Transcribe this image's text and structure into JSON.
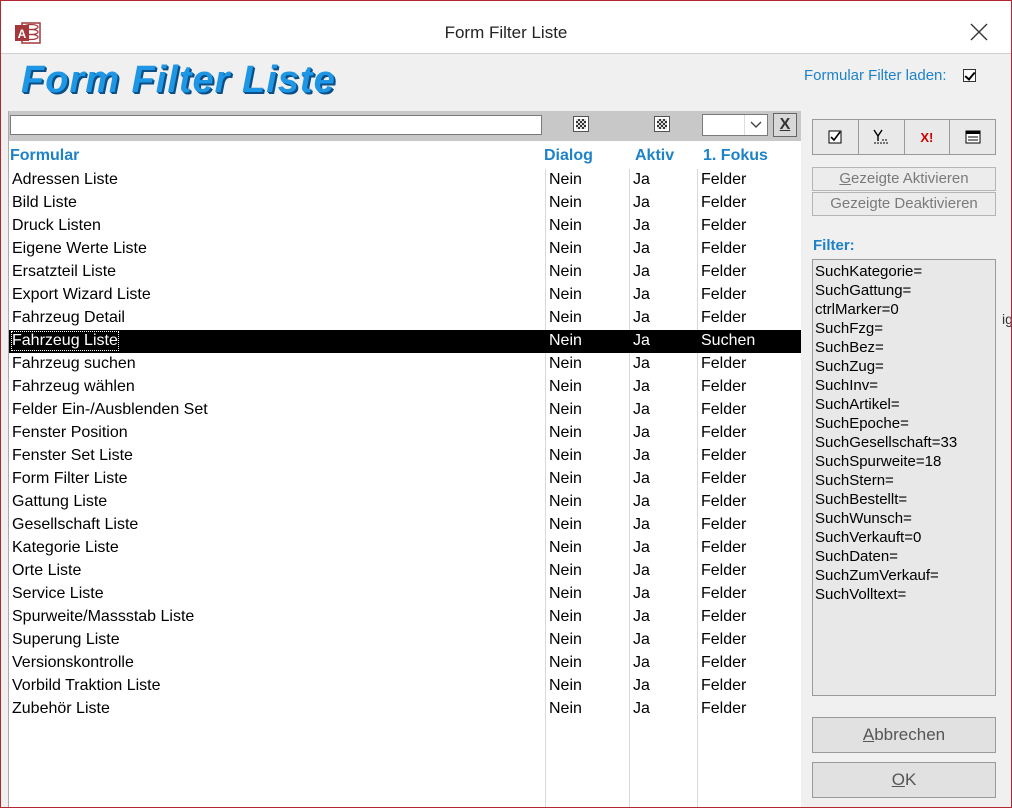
{
  "window": {
    "title": "Form Filter Liste",
    "app_icon": "access-icon",
    "close_icon": "close-icon"
  },
  "header": {
    "big_title": "Form Filter Liste",
    "formular_filter_label": "Formular Filter laden:",
    "formular_filter_checked": true
  },
  "filter_bar": {
    "search_value": "",
    "combo_value": "",
    "clear_label": "X"
  },
  "columns": [
    "Formular",
    "Dialog",
    "Aktiv",
    "1. Fokus"
  ],
  "rows": [
    {
      "name": "Adressen Liste",
      "dialog": "Nein",
      "aktiv": "Ja",
      "fokus": "Felder"
    },
    {
      "name": "Bild Liste",
      "dialog": "Nein",
      "aktiv": "Ja",
      "fokus": "Felder"
    },
    {
      "name": "Druck Listen",
      "dialog": "Nein",
      "aktiv": "Ja",
      "fokus": "Felder"
    },
    {
      "name": "Eigene Werte Liste",
      "dialog": "Nein",
      "aktiv": "Ja",
      "fokus": "Felder"
    },
    {
      "name": "Ersatzteil Liste",
      "dialog": "Nein",
      "aktiv": "Ja",
      "fokus": "Felder"
    },
    {
      "name": "Export Wizard Liste",
      "dialog": "Nein",
      "aktiv": "Ja",
      "fokus": "Felder"
    },
    {
      "name": "Fahrzeug Detail",
      "dialog": "Nein",
      "aktiv": "Ja",
      "fokus": "Felder"
    },
    {
      "name": "Fahrzeug Liste",
      "dialog": "Nein",
      "aktiv": "Ja",
      "fokus": "Suchen",
      "selected": true
    },
    {
      "name": "Fahrzeug suchen",
      "dialog": "Nein",
      "aktiv": "Ja",
      "fokus": "Felder"
    },
    {
      "name": "Fahrzeug wählen",
      "dialog": "Nein",
      "aktiv": "Ja",
      "fokus": "Felder"
    },
    {
      "name": "Felder Ein-/Ausblenden Set",
      "dialog": "Nein",
      "aktiv": "Ja",
      "fokus": "Felder"
    },
    {
      "name": "Fenster Position",
      "dialog": "Nein",
      "aktiv": "Ja",
      "fokus": "Felder"
    },
    {
      "name": "Fenster Set Liste",
      "dialog": "Nein",
      "aktiv": "Ja",
      "fokus": "Felder"
    },
    {
      "name": "Form Filter Liste",
      "dialog": "Nein",
      "aktiv": "Ja",
      "fokus": "Felder"
    },
    {
      "name": "Gattung Liste",
      "dialog": "Nein",
      "aktiv": "Ja",
      "fokus": "Felder"
    },
    {
      "name": "Gesellschaft Liste",
      "dialog": "Nein",
      "aktiv": "Ja",
      "fokus": "Felder"
    },
    {
      "name": "Kategorie Liste",
      "dialog": "Nein",
      "aktiv": "Ja",
      "fokus": "Felder"
    },
    {
      "name": "Orte Liste",
      "dialog": "Nein",
      "aktiv": "Ja",
      "fokus": "Felder"
    },
    {
      "name": "Service Liste",
      "dialog": "Nein",
      "aktiv": "Ja",
      "fokus": "Felder"
    },
    {
      "name": "Spurweite/Massstab Liste",
      "dialog": "Nein",
      "aktiv": "Ja",
      "fokus": "Felder"
    },
    {
      "name": "Superung Liste",
      "dialog": "Nein",
      "aktiv": "Ja",
      "fokus": "Felder"
    },
    {
      "name": "Versionskontrolle",
      "dialog": "Nein",
      "aktiv": "Ja",
      "fokus": "Felder"
    },
    {
      "name": "Vorbild Traktion Liste",
      "dialog": "Nein",
      "aktiv": "Ja",
      "fokus": "Felder"
    },
    {
      "name": "Zubehör Liste",
      "dialog": "Nein",
      "aktiv": "Ja",
      "fokus": "Felder"
    }
  ],
  "toolbar": {
    "buttons": [
      "check-all-icon",
      "filter-sum-icon",
      "delete-filter-icon",
      "form-view-icon"
    ],
    "delete_label": "X!"
  },
  "actions": {
    "activate": {
      "prefix": "G",
      "rest": "ezeigte Aktivieren"
    },
    "deactivate": "Gezeigte Deaktivieren",
    "cancel": {
      "prefix": "A",
      "rest": "bbrechen"
    },
    "ok": {
      "prefix": "O",
      "rest": "K"
    }
  },
  "filter": {
    "label": "Filter:",
    "lines": [
      "SuchKategorie=",
      "SuchGattung=",
      "ctrlMarker=0",
      "SuchFzg=",
      "SuchBez=",
      "SuchZug=",
      "SuchInv=",
      "SuchArtikel=",
      "SuchEpoche=",
      "SuchGesellschaft=33",
      "SuchSpurweite=18",
      "SuchStern=",
      "SuchBestellt=",
      "SuchWunsch=",
      "SuchVerkauft=0",
      "SuchDaten=",
      "SuchZumVerkauf=",
      "SuchVolltext="
    ]
  },
  "background_fragment": "ig",
  "colors": {
    "accent": "#1e82c8",
    "title_blue": "#1e96e6",
    "window_border": "#b0292e",
    "selection": "#000000"
  }
}
